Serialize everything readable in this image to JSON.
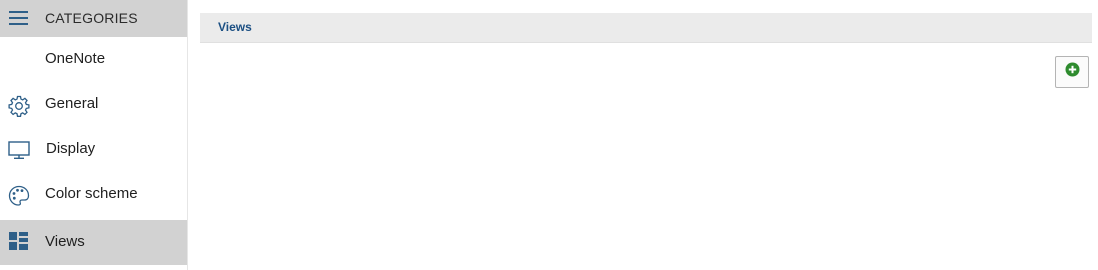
{
  "sidebar": {
    "header": {
      "title": "CATEGORIES",
      "icon": "hamburger-menu-icon"
    },
    "items": [
      {
        "label": "OneNote",
        "icon": "none",
        "active": false
      },
      {
        "label": "General",
        "icon": "gear-icon",
        "active": false
      },
      {
        "label": "Display",
        "icon": "monitor-icon",
        "active": false
      },
      {
        "label": "Color scheme",
        "icon": "palette-icon",
        "active": false
      },
      {
        "label": "Views",
        "icon": "views-grid-icon",
        "active": true
      }
    ]
  },
  "main": {
    "section_title": "Views",
    "add_button_icon": "plus-circle-icon"
  },
  "colors": {
    "accent_blue": "#1b4f83",
    "icon_blue": "#2e5f88",
    "active_bg": "#d2d2d2",
    "add_green": "#2e8b2e"
  }
}
